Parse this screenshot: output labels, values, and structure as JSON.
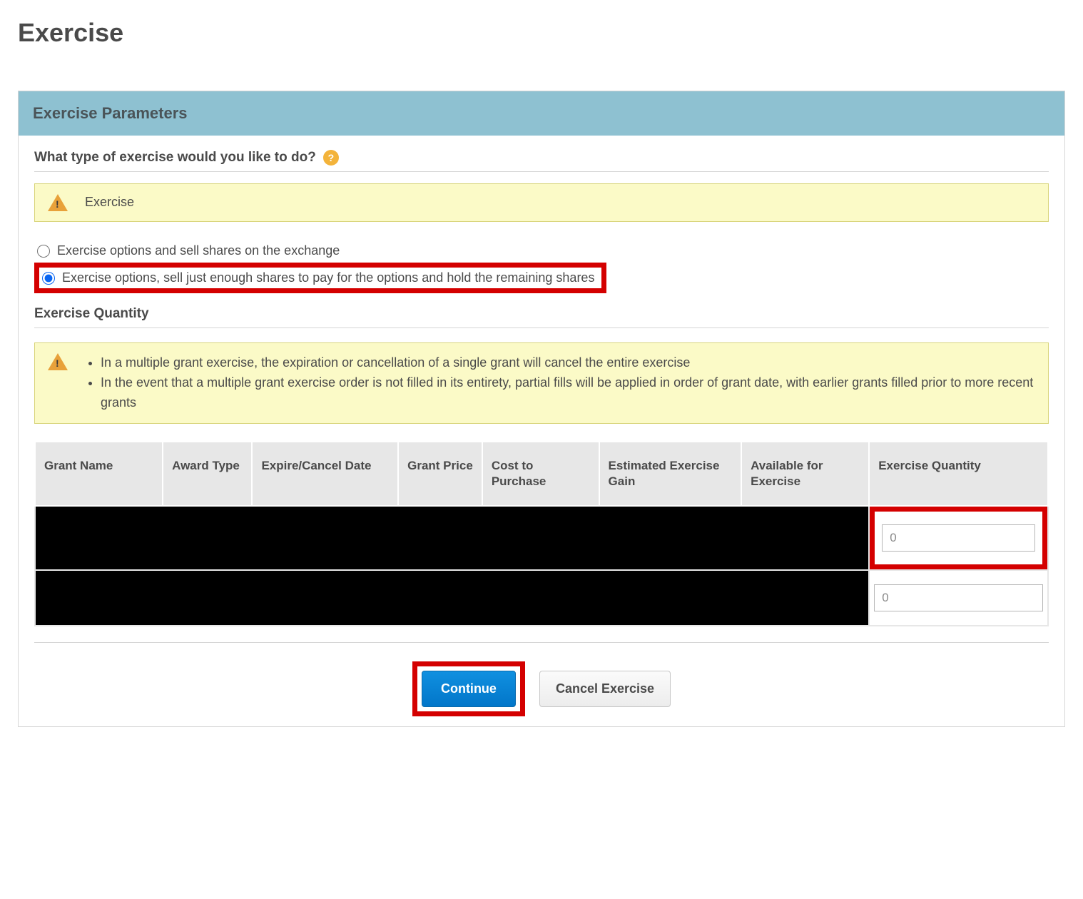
{
  "page": {
    "title": "Exercise"
  },
  "panel": {
    "header": "Exercise Parameters",
    "question": "What type of exercise would you like to do?",
    "alert_top": "Exercise"
  },
  "options": {
    "opt1": "Exercise options and sell shares on the exchange",
    "opt2": "Exercise options, sell just enough shares to pay for the options and hold the remaining shares"
  },
  "quantity_section": {
    "title": "Exercise Quantity",
    "notes": {
      "n1": "In a multiple grant exercise, the expiration or cancellation of a single grant will cancel the entire exercise",
      "n2": "In the event that a multiple grant exercise order is not filled in its entirety, partial fills will be applied in order of grant date, with earlier grants filled prior to more recent grants"
    }
  },
  "table": {
    "headers": {
      "grant_name": "Grant Name",
      "award_type": "Award Type",
      "expire": "Expire/Cancel Date",
      "grant_price": "Grant Price",
      "cost": "Cost to Purchase",
      "gain": "Estimated Exercise Gain",
      "available": "Available for Exercise",
      "qty": "Exercise Quantity"
    },
    "rows": [
      {
        "qty": "0"
      },
      {
        "qty": "0"
      }
    ]
  },
  "buttons": {
    "continue": "Continue",
    "cancel": "Cancel Exercise"
  }
}
